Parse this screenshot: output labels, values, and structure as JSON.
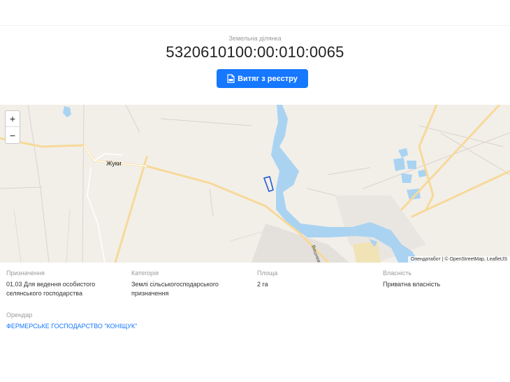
{
  "header": {
    "subtitle": "Земельна ділянка",
    "cadastral_number": "5320610100:00:010:0065",
    "extract_button_label": "Витяг з реєстру"
  },
  "map": {
    "zoom_in_label": "+",
    "zoom_out_label": "−",
    "village_label": "Жуки",
    "road_label": "Вишнева",
    "attribution": "Опендатабот | © OpenStreetMap, LeafletJS",
    "colors": {
      "background": "#f2efe9",
      "water": "#aad3f2",
      "road": "#f7d999",
      "parcel": "#1e5bd6"
    }
  },
  "details": {
    "purpose": {
      "label": "Призначення",
      "value_line1": "01.03 Для ведення особистого",
      "value_line2": "селянського господарства"
    },
    "category": {
      "label": "Категорія",
      "value_line1": "Землі сільськогосподарського",
      "value_line2": "призначення"
    },
    "area": {
      "label": "Площа",
      "value": "2 га"
    },
    "ownership": {
      "label": "Власність",
      "value": "Приватна власність"
    },
    "tenant": {
      "label": "Орендар",
      "value": "ФЕРМЕРСЬКЕ ГОСПОДАРСТВО \"КОНІЩУК\""
    }
  },
  "accent_color": "#1677ff"
}
